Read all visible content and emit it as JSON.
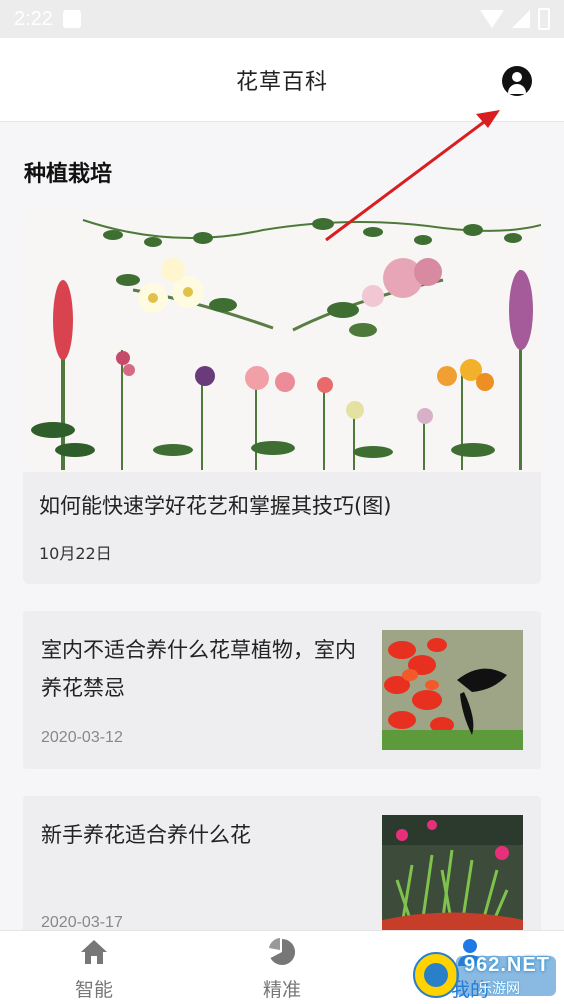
{
  "status_bar": {
    "time": "2:22"
  },
  "header": {
    "title": "花草百科",
    "profile_icon": "user-avatar-icon"
  },
  "section": {
    "title": "种植栽培"
  },
  "feature": {
    "title": "如何能快速学好花艺和掌握其技巧(图)",
    "date": "10月22日",
    "image": "flower-arrangement-photo"
  },
  "list": [
    {
      "title": "室内不适合养什么花草植物，室内养花禁忌",
      "date": "2020-03-12",
      "image": "red-flowers-butterfly-photo"
    },
    {
      "title": "新手养花适合养什么花",
      "date": "2020-03-17",
      "image": "potted-succulent-photo"
    }
  ],
  "bottom_nav": [
    {
      "label": "智能",
      "icon": "home-icon"
    },
    {
      "label": "精准",
      "icon": "pie-chart-icon"
    },
    {
      "label": "我的",
      "icon": "person-icon"
    }
  ],
  "watermark": {
    "text": "962.NET",
    "sub": "乐游网"
  },
  "colors": {
    "accent": "#1e78e6",
    "arrow": "#d81e1e",
    "card_bg": "#eeeef1"
  }
}
